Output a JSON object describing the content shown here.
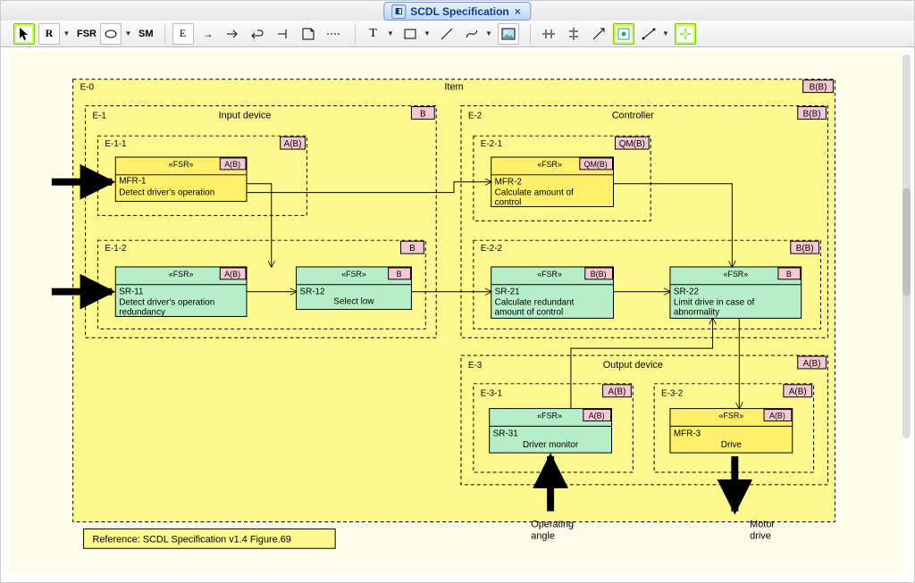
{
  "tab": {
    "title": "SCDL Specification"
  },
  "toolbar": {
    "fsr": "FSR",
    "sm": "SM"
  },
  "reference": "Reference: SCDL Specification v1.4 Figure.69",
  "containers": {
    "e0": {
      "id": "E-0",
      "title": "Item",
      "badge": "B(B)"
    },
    "e1": {
      "id": "E-1",
      "title": "Input device",
      "badge": "B"
    },
    "e11": {
      "id": "E-1-1",
      "title": "",
      "badge": "A(B)"
    },
    "e12": {
      "id": "E-1-2",
      "title": "",
      "badge": "B"
    },
    "e2": {
      "id": "E-2",
      "title": "Controller",
      "badge": "B(B)"
    },
    "e21": {
      "id": "E-2-1",
      "title": "",
      "badge": "QM(B)"
    },
    "e22": {
      "id": "E-2-2",
      "title": "",
      "badge": "B(B)"
    },
    "e3": {
      "id": "E-3",
      "title": "Output device",
      "badge": "A(B)"
    },
    "e31": {
      "id": "E-3-1",
      "title": "",
      "badge": "A(B)"
    },
    "e32": {
      "id": "E-3-2",
      "title": "",
      "badge": "A(B)"
    }
  },
  "blocks": {
    "mfr1": {
      "id": "MFR-1",
      "stereo": "«FSR»",
      "badge": "A(B)",
      "text1": "Detect driver's operation",
      "text2": ""
    },
    "sr11": {
      "id": "SR-11",
      "stereo": "«FSR»",
      "badge": "A(B)",
      "text1": "Detect driver's operation",
      "text2": "redundancy"
    },
    "sr12": {
      "id": "SR-12",
      "stereo": "«FSR»",
      "badge": "B",
      "text1": "Select low",
      "text2": ""
    },
    "mfr2": {
      "id": "MFR-2",
      "stereo": "«FSR»",
      "badge": "QM(B)",
      "text1": "Calculate amount of",
      "text2": "control"
    },
    "sr21": {
      "id": "SR-21",
      "stereo": "«FSR»",
      "badge": "B(B)",
      "text1": "Calculate redundant",
      "text2": "amount of control"
    },
    "sr22": {
      "id": "SR-22",
      "stereo": "«FSR»",
      "badge": "B",
      "text1": "Limit drive in case of",
      "text2": "abnormality"
    },
    "sr31": {
      "id": "SR-31",
      "stereo": "«FSR»",
      "badge": "A(B)",
      "text1": "Driver monitor",
      "text2": ""
    },
    "mfr3": {
      "id": "MFR-3",
      "stereo": "«FSR»",
      "badge": "A(B)",
      "text1": "Drive",
      "text2": ""
    }
  },
  "labels": {
    "op_angle1": "Operating",
    "op_angle2": "angle",
    "motor1": "Motor",
    "motor2": "drive"
  },
  "colors": {
    "canvas": "#fef98f",
    "yellow": "#fff06a",
    "green": "#b6eec8",
    "pink": "#f6c9d2",
    "border": "#000000"
  }
}
